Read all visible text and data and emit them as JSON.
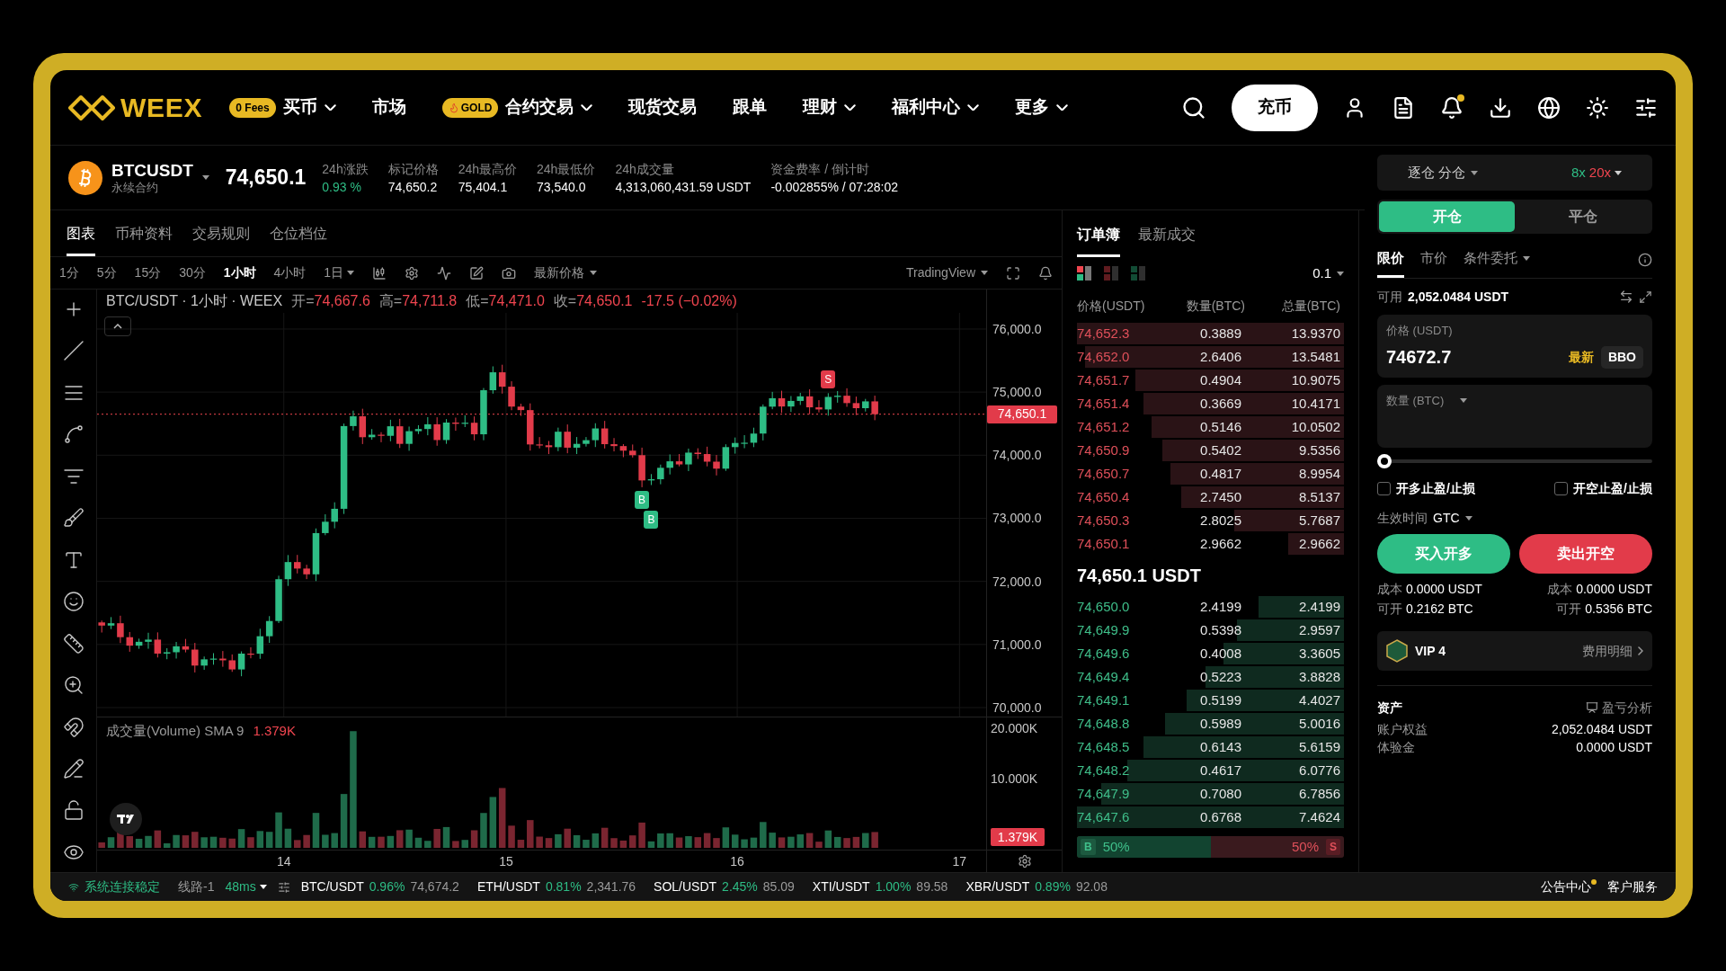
{
  "nav": {
    "logo": "WEEX",
    "items": [
      {
        "label": "买币",
        "badge": {
          "text": "0 Fees",
          "kind": "fees"
        },
        "dropdown": true
      },
      {
        "label": "市场",
        "dropdown": false
      },
      {
        "label": "合约交易",
        "badge": {
          "text": "GOLD",
          "kind": "gold"
        },
        "dropdown": true
      },
      {
        "label": "现货交易",
        "dropdown": false
      },
      {
        "label": "跟单",
        "dropdown": false
      },
      {
        "label": "理财",
        "dropdown": true
      },
      {
        "label": "福利中心",
        "dropdown": true
      },
      {
        "label": "更多",
        "dropdown": true
      }
    ],
    "deposit": "充币",
    "notification_dot": true
  },
  "ticker": {
    "symbol": "BTCUSDT",
    "subtitle": "永续合约",
    "price": "74,650.1",
    "stats": [
      {
        "label": "24h涨跌",
        "value": "0.93 %",
        "kind": "up"
      },
      {
        "label": "标记价格",
        "value": "74,650.2",
        "kind": "plain"
      },
      {
        "label": "24h最高价",
        "value": "75,404.1",
        "kind": "plain"
      },
      {
        "label": "24h最低价",
        "value": "73,540.0",
        "kind": "plain"
      },
      {
        "label": "24h成交量",
        "value": "4,313,060,431.59 USDT",
        "kind": "plain"
      },
      {
        "label": "资金费率 / 倒计时",
        "value": "-0.002855% / 07:28:02",
        "kind": "plain"
      }
    ]
  },
  "chart_panel": {
    "tabs": [
      {
        "label": "图表",
        "selected": true
      },
      {
        "label": "币种资料",
        "selected": false
      },
      {
        "label": "交易规则",
        "selected": false
      },
      {
        "label": "仓位档位",
        "selected": false
      }
    ],
    "intervals": [
      {
        "label": "1分",
        "selected": false,
        "dropdown": false
      },
      {
        "label": "5分",
        "selected": false,
        "dropdown": false
      },
      {
        "label": "15分",
        "selected": false,
        "dropdown": false
      },
      {
        "label": "30分",
        "selected": false,
        "dropdown": false
      },
      {
        "label": "1小时",
        "selected": true,
        "dropdown": false
      },
      {
        "label": "4小时",
        "selected": false,
        "dropdown": false
      },
      {
        "label": "1日",
        "selected": false,
        "dropdown": true
      }
    ],
    "price_type": "最新价格",
    "provider": "TradingView",
    "legend": {
      "title": "BTC/USDT · 1小时 · WEEX",
      "ohlc": [
        {
          "label": "开=",
          "value": "74,667.6"
        },
        {
          "label": "高=",
          "value": "74,711.8"
        },
        {
          "label": "低=",
          "value": "74,471.0"
        },
        {
          "label": "收=",
          "value": "74,650.1"
        }
      ],
      "change": "-17.5 (−0.02%)"
    },
    "price_ticks": [
      "76,000.0",
      "75,000.0",
      "74,000.0",
      "73,000.0",
      "72,000.0",
      "71,000.0",
      "70,000.0"
    ],
    "last_price": "74,650.1",
    "markers": [
      {
        "label": "S",
        "kind": "sell"
      },
      {
        "label": "B",
        "kind": "buy"
      },
      {
        "label": "B",
        "kind": "buy"
      }
    ],
    "volume_legend": {
      "title": "成交量(Volume) SMA 9",
      "value": "1.379K"
    },
    "volume_ticks": [
      "20.000K",
      "10.000K"
    ],
    "last_volume": "1.379K",
    "time_ticks": [
      "14",
      "15",
      "16",
      "17"
    ]
  },
  "order_book": {
    "tabs": [
      {
        "label": "订单簿",
        "selected": true
      },
      {
        "label": "最新成交",
        "selected": false
      }
    ],
    "views": [
      {
        "kind": "both",
        "selected": true
      },
      {
        "kind": "asks",
        "selected": false
      },
      {
        "kind": "bids",
        "selected": false
      }
    ],
    "precision": "0.1",
    "columns": [
      "价格(USDT)",
      "数量(BTC)",
      "总量(BTC)"
    ],
    "asks": [
      {
        "price": "74,652.3",
        "qty": "0.3889",
        "total": "13.9370",
        "level": 1.0
      },
      {
        "price": "74,652.0",
        "qty": "2.6406",
        "total": "13.5481",
        "level": 0.97
      },
      {
        "price": "74,651.7",
        "qty": "0.4904",
        "total": "10.9075",
        "level": 0.78
      },
      {
        "price": "74,651.4",
        "qty": "0.3669",
        "total": "10.4171",
        "level": 0.75
      },
      {
        "price": "74,651.2",
        "qty": "0.5146",
        "total": "10.0502",
        "level": 0.72
      },
      {
        "price": "74,650.9",
        "qty": "0.5402",
        "total": "9.5356",
        "level": 0.68
      },
      {
        "price": "74,650.7",
        "qty": "0.4817",
        "total": "8.9954",
        "level": 0.65
      },
      {
        "price": "74,650.4",
        "qty": "2.7450",
        "total": "8.5137",
        "level": 0.61
      },
      {
        "price": "74,650.3",
        "qty": "2.8025",
        "total": "5.7687",
        "level": 0.41
      },
      {
        "price": "74,650.1",
        "qty": "2.9662",
        "total": "2.9662",
        "level": 0.21
      }
    ],
    "mid_price": "74,650.1 USDT",
    "bids": [
      {
        "price": "74,650.0",
        "qty": "2.4199",
        "total": "2.4199",
        "level": 0.32
      },
      {
        "price": "74,649.9",
        "qty": "0.5398",
        "total": "2.9597",
        "level": 0.4
      },
      {
        "price": "74,649.6",
        "qty": "0.4008",
        "total": "3.3605",
        "level": 0.45
      },
      {
        "price": "74,649.4",
        "qty": "0.5223",
        "total": "3.8828",
        "level": 0.52
      },
      {
        "price": "74,649.1",
        "qty": "0.5199",
        "total": "4.4027",
        "level": 0.59
      },
      {
        "price": "74,648.8",
        "qty": "0.5989",
        "total": "5.0016",
        "level": 0.67
      },
      {
        "price": "74,648.5",
        "qty": "0.6143",
        "total": "5.6159",
        "level": 0.75
      },
      {
        "price": "74,648.2",
        "qty": "0.4617",
        "total": "6.0776",
        "level": 0.81
      },
      {
        "price": "74,647.9",
        "qty": "0.7080",
        "total": "6.7856",
        "level": 0.91
      },
      {
        "price": "74,647.6",
        "qty": "0.6768",
        "total": "7.4624",
        "level": 1.0
      }
    ],
    "ratio": {
      "buy_label": "B",
      "buy": "50%",
      "sell": "50%",
      "sell_label": "S",
      "level": 0.5
    }
  },
  "trade_panel": {
    "margin_mode": "逐仓 分仓",
    "leverage_long": "8x",
    "leverage_short": "20x",
    "modes": [
      {
        "label": "开仓",
        "selected": true
      },
      {
        "label": "平仓",
        "selected": false
      }
    ],
    "order_types": [
      {
        "label": "限价",
        "selected": true,
        "dropdown": false
      },
      {
        "label": "市价",
        "selected": false,
        "dropdown": false
      },
      {
        "label": "条件委托",
        "selected": false,
        "dropdown": true
      }
    ],
    "available_label": "可用",
    "available": "2,052.0484 USDT",
    "price_field": {
      "label": "价格 (USDT)",
      "value": "74672.7",
      "latest": "最新",
      "bbo": "BBO"
    },
    "qty_field": {
      "placeholder": "数量 (BTC)"
    },
    "slider": {
      "level": 0
    },
    "checkboxes": [
      {
        "label": "开多止盈/止损",
        "checked": false
      },
      {
        "label": "开空止盈/止损",
        "checked": false
      }
    ],
    "tif_label": "生效时间",
    "tif": "GTC",
    "buy_button": "买入开多",
    "sell_button": "卖出开空",
    "costs": [
      [
        {
          "label": "成本",
          "value": "0.0000 USDT"
        },
        {
          "label": "可开",
          "value": "0.2162 BTC"
        }
      ],
      [
        {
          "label": "成本",
          "value": "0.0000 USDT"
        },
        {
          "label": "可开",
          "value": "0.5356 BTC"
        }
      ]
    ],
    "vip": {
      "label": "VIP 4",
      "link": "费用明细"
    },
    "assets": {
      "title": "资产",
      "analysis": "盈亏分析",
      "rows": [
        {
          "label": "账户权益",
          "value": "2,052.0484 USDT"
        },
        {
          "label": "体验金",
          "value": "0.0000 USDT"
        }
      ]
    }
  },
  "status_bar": {
    "connection": "系统连接稳定",
    "line": "线路-1",
    "latency": "48ms",
    "pairs": [
      {
        "pair": "BTC/USDT",
        "change": "0.96%",
        "price": "74,674.2"
      },
      {
        "pair": "ETH/USDT",
        "change": "0.81%",
        "price": "2,341.76"
      },
      {
        "pair": "SOL/USDT",
        "change": "2.45%",
        "price": "85.09"
      },
      {
        "pair": "XTI/USDT",
        "change": "1.00%",
        "price": "89.58"
      },
      {
        "pair": "XBR/USDT",
        "change": "0.89%",
        "price": "92.08"
      }
    ],
    "announcements": "公告中心",
    "announcement_dot": true,
    "support": "客户服务"
  }
}
